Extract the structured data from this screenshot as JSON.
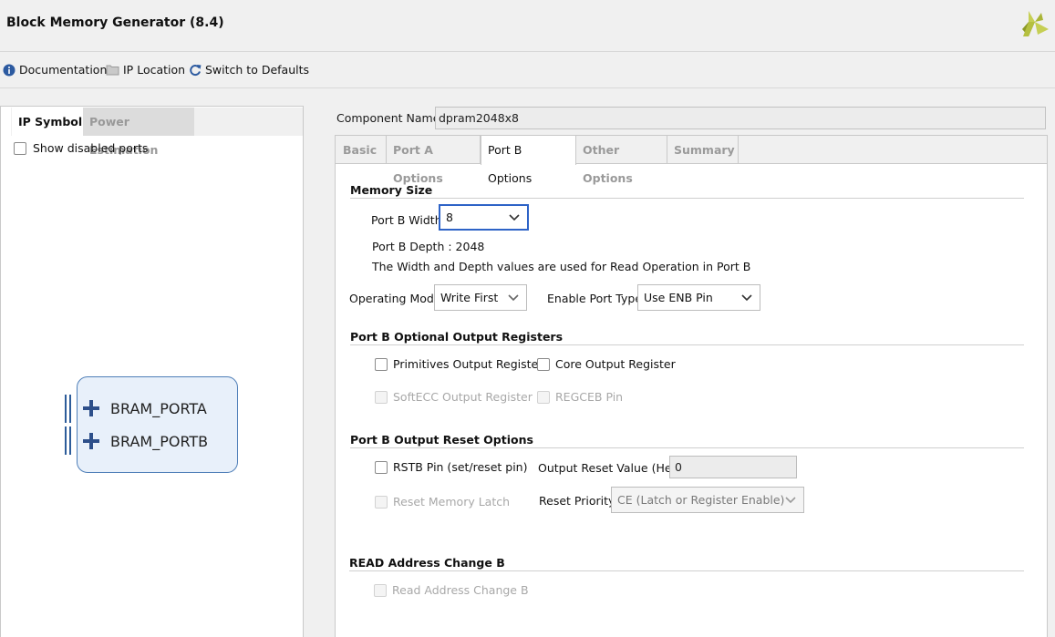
{
  "header": {
    "title": "Block Memory Generator (8.4)",
    "logo_icon": "xilinx-logo-icon"
  },
  "toolbar": {
    "documentation_label": "Documentation",
    "ip_location_label": "IP Location",
    "switch_defaults_label": "Switch to Defaults"
  },
  "left_panel": {
    "tabs": [
      {
        "label": "IP Symbol",
        "active": true
      },
      {
        "label": "Power Estimation",
        "active": false
      }
    ],
    "show_disabled_ports_label": "Show disabled ports",
    "show_disabled_ports_checked": false,
    "symbol": {
      "ports": [
        "BRAM_PORTA",
        "BRAM_PORTB"
      ]
    }
  },
  "component": {
    "label": "Component Name",
    "value": "dpram2048x8"
  },
  "tabs": [
    {
      "label": "Basic",
      "active": false
    },
    {
      "label": "Port A Options",
      "active": false
    },
    {
      "label": "Port B Options",
      "active": true
    },
    {
      "label": "Other Options",
      "active": false
    },
    {
      "label": "Summary",
      "active": false
    }
  ],
  "memory_size": {
    "title": "Memory Size",
    "port_b_width_label": "Port B Width",
    "port_b_width_value": "8",
    "port_b_depth_text": "Port B Depth : 2048",
    "note": "The Width and Depth values are used for Read Operation in Port B",
    "operating_mode_label": "Operating Mode",
    "operating_mode_value": "Write First",
    "enable_port_type_label": "Enable Port Type",
    "enable_port_type_value": "Use ENB Pin"
  },
  "output_registers": {
    "title": "Port B Optional Output Registers",
    "primitives_label": "Primitives Output Register",
    "core_label": "Core Output Register",
    "softecc_label": "SoftECC Output Register",
    "regceb_label": "REGCEB Pin"
  },
  "reset_options": {
    "title": "Port B Output Reset Options",
    "rstb_label": "RSTB Pin (set/reset pin)",
    "output_reset_value_label": "Output Reset Value (Hex)",
    "output_reset_value": "0",
    "reset_memory_latch_label": "Reset Memory Latch",
    "reset_priority_label": "Reset Priority",
    "reset_priority_value": "CE (Latch or Register Enable)"
  },
  "read_address": {
    "title": "READ Address Change B",
    "checkbox_label": "Read Address Change B"
  },
  "colors": {
    "accent_focus": "#2e63c7",
    "symbol_fill": "#e8f0fa",
    "symbol_border": "#4f7fb8",
    "logo_green": "#a9b536"
  }
}
